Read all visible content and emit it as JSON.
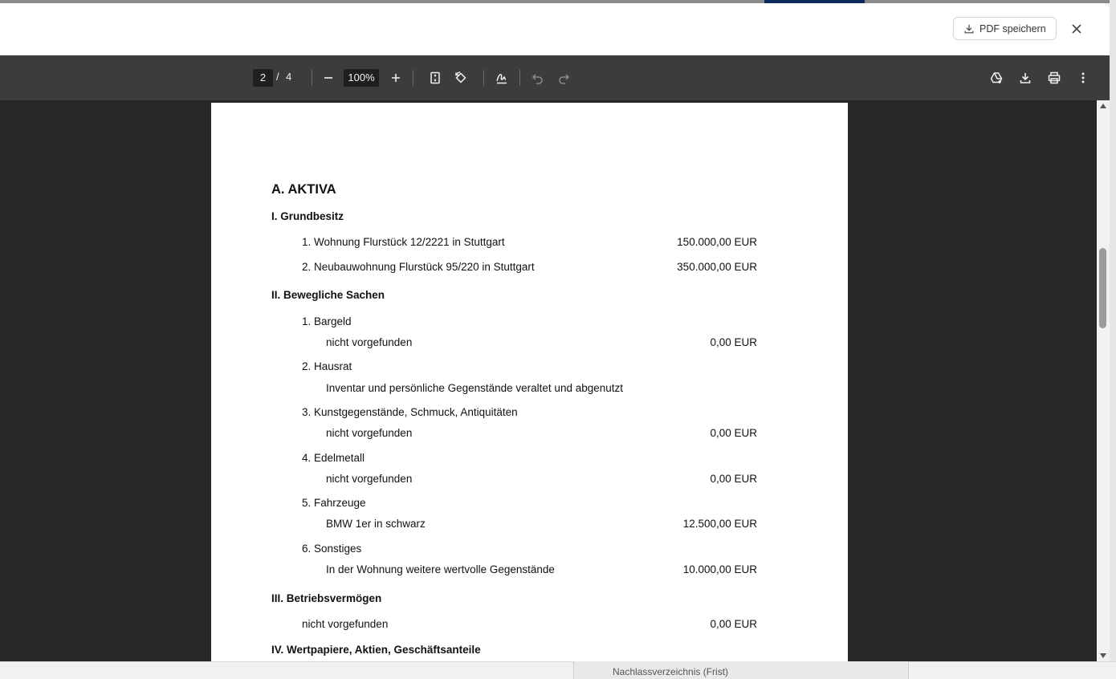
{
  "header": {
    "save_label": "PDF speichern"
  },
  "toolbar": {
    "current_page": "2",
    "page_separator": "/",
    "total_pages": "4",
    "zoom": "100%"
  },
  "document": {
    "title": "A. AKTIVA",
    "sections": [
      {
        "heading": "I. Grundbesitz",
        "items": [
          {
            "label": "1. Wohnung Flurstück 12/2221 in Stuttgart",
            "amount": "150.000,00 EUR"
          },
          {
            "label": "2. Neubauwohnung Flurstück 95/220 in Stuttgart",
            "amount": "350.000,00 EUR"
          }
        ]
      },
      {
        "heading": "II. Bewegliche Sachen",
        "items": [
          {
            "label": "1. Bargeld",
            "detail": "nicht vorgefunden",
            "amount": "0,00 EUR"
          },
          {
            "label": "2. Hausrat",
            "detail": "Inventar und persönliche Gegenstände veraltet und abgenutzt",
            "amount": ""
          },
          {
            "label": "3. Kunstgegenstände, Schmuck, Antiquitäten",
            "detail": "nicht vorgefunden",
            "amount": "0,00 EUR"
          },
          {
            "label": "4. Edelmetall",
            "detail": "nicht vorgefunden",
            "amount": "0,00 EUR"
          },
          {
            "label": "5. Fahrzeuge",
            "detail": "BMW 1er in schwarz",
            "amount": "12.500,00 EUR"
          },
          {
            "label": "6. Sonstiges",
            "detail": "In der Wohnung weitere wertvolle Gegenstände",
            "amount": "10.000,00 EUR"
          }
        ]
      },
      {
        "heading": "III. Betriebsvermögen",
        "items": [
          {
            "label": "nicht vorgefunden",
            "amount": "0,00 EUR"
          }
        ]
      },
      {
        "heading": "IV. Wertpapiere, Aktien, Geschäftsanteile",
        "items": []
      }
    ]
  },
  "background": {
    "bottom_label": "Nachlassverzeichnis (Frist)"
  },
  "colors": {
    "toolbar_bg": "#3c3c3c",
    "viewer_bg": "#282828",
    "accent": "#0b2a5c"
  }
}
